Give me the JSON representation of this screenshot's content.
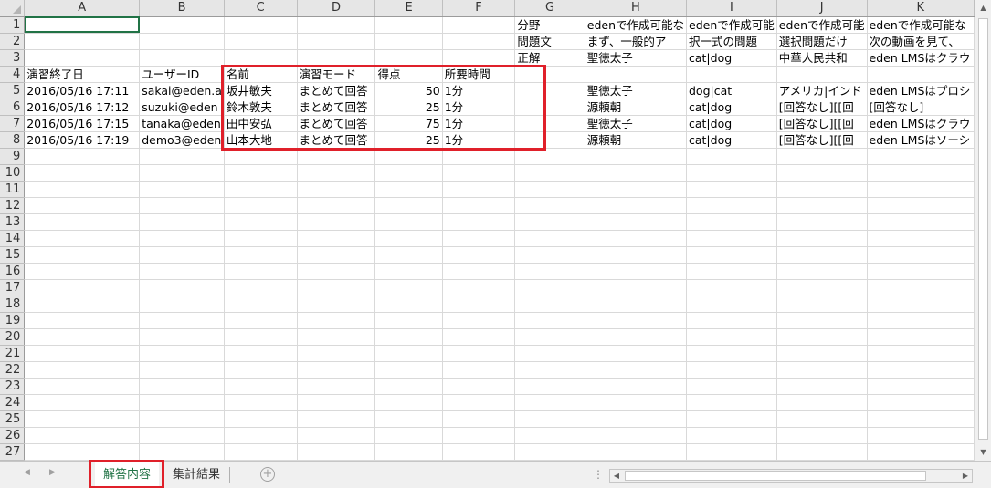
{
  "columns": [
    "A",
    "B",
    "C",
    "D",
    "E",
    "F",
    "G",
    "H",
    "I",
    "J",
    "K"
  ],
  "rows": [
    {
      "n": "1",
      "cells": [
        "",
        "",
        "",
        "",
        "",
        "",
        "分野",
        "edenで作成可能な",
        "edenで作成可能",
        "edenで作成可能",
        "edenで作成可能な"
      ]
    },
    {
      "n": "2",
      "cells": [
        "",
        "",
        "",
        "",
        "",
        "",
        "問題文",
        "まず、一般的ア",
        "択一式の問題",
        "選択問題だけ",
        "次の動画を見て、"
      ]
    },
    {
      "n": "3",
      "cells": [
        "",
        "",
        "",
        "",
        "",
        "",
        "正解",
        "聖徳太子",
        "cat|dog",
        "中華人民共和",
        "eden LMSはクラウ"
      ]
    },
    {
      "n": "4",
      "cells": [
        "演習終了日",
        "ユーザーID",
        "名前",
        "演習モード",
        "得点",
        "所要時間",
        "",
        "",
        "",
        "",
        ""
      ]
    },
    {
      "n": "5",
      "cells": [
        "2016/05/16 17:11",
        "sakai@eden.a",
        "坂井敏夫",
        "まとめて回答",
        "50",
        "1分",
        "",
        "聖徳太子",
        "dog|cat",
        "アメリカ|インド",
        "eden LMSはプロシ"
      ]
    },
    {
      "n": "6",
      "cells": [
        "2016/05/16 17:12",
        "suzuki@eden",
        "鈴木敦夫",
        "まとめて回答",
        "25",
        "1分",
        "",
        "源頼朝",
        "cat|dog",
        "[回答なし][[回",
        "[回答なし]"
      ]
    },
    {
      "n": "7",
      "cells": [
        "2016/05/16 17:15",
        "tanaka@eden",
        "田中安弘",
        "まとめて回答",
        "75",
        "1分",
        "",
        "聖徳太子",
        "cat|dog",
        "[回答なし][[回",
        "eden LMSはクラウ"
      ]
    },
    {
      "n": "8",
      "cells": [
        "2016/05/16 17:19",
        "demo3@eden",
        "山本大地",
        "まとめて回答",
        "25",
        "1分",
        "",
        "源頼朝",
        "cat|dog",
        "[回答なし][[回",
        "eden LMSはソーシ"
      ]
    },
    {
      "n": "9",
      "cells": [
        "",
        "",
        "",
        "",
        "",
        "",
        "",
        "",
        "",
        "",
        ""
      ]
    },
    {
      "n": "10",
      "cells": [
        "",
        "",
        "",
        "",
        "",
        "",
        "",
        "",
        "",
        "",
        ""
      ]
    },
    {
      "n": "11",
      "cells": [
        "",
        "",
        "",
        "",
        "",
        "",
        "",
        "",
        "",
        "",
        ""
      ]
    },
    {
      "n": "12",
      "cells": [
        "",
        "",
        "",
        "",
        "",
        "",
        "",
        "",
        "",
        "",
        ""
      ]
    },
    {
      "n": "13",
      "cells": [
        "",
        "",
        "",
        "",
        "",
        "",
        "",
        "",
        "",
        "",
        ""
      ]
    },
    {
      "n": "14",
      "cells": [
        "",
        "",
        "",
        "",
        "",
        "",
        "",
        "",
        "",
        "",
        ""
      ]
    },
    {
      "n": "15",
      "cells": [
        "",
        "",
        "",
        "",
        "",
        "",
        "",
        "",
        "",
        "",
        ""
      ]
    },
    {
      "n": "16",
      "cells": [
        "",
        "",
        "",
        "",
        "",
        "",
        "",
        "",
        "",
        "",
        ""
      ]
    },
    {
      "n": "17",
      "cells": [
        "",
        "",
        "",
        "",
        "",
        "",
        "",
        "",
        "",
        "",
        ""
      ]
    },
    {
      "n": "18",
      "cells": [
        "",
        "",
        "",
        "",
        "",
        "",
        "",
        "",
        "",
        "",
        ""
      ]
    },
    {
      "n": "19",
      "cells": [
        "",
        "",
        "",
        "",
        "",
        "",
        "",
        "",
        "",
        "",
        ""
      ]
    },
    {
      "n": "20",
      "cells": [
        "",
        "",
        "",
        "",
        "",
        "",
        "",
        "",
        "",
        "",
        ""
      ]
    },
    {
      "n": "21",
      "cells": [
        "",
        "",
        "",
        "",
        "",
        "",
        "",
        "",
        "",
        "",
        ""
      ]
    },
    {
      "n": "22",
      "cells": [
        "",
        "",
        "",
        "",
        "",
        "",
        "",
        "",
        "",
        "",
        ""
      ]
    },
    {
      "n": "23",
      "cells": [
        "",
        "",
        "",
        "",
        "",
        "",
        "",
        "",
        "",
        "",
        ""
      ]
    },
    {
      "n": "24",
      "cells": [
        "",
        "",
        "",
        "",
        "",
        "",
        "",
        "",
        "",
        "",
        ""
      ]
    },
    {
      "n": "25",
      "cells": [
        "",
        "",
        "",
        "",
        "",
        "",
        "",
        "",
        "",
        "",
        ""
      ]
    },
    {
      "n": "26",
      "cells": [
        "",
        "",
        "",
        "",
        "",
        "",
        "",
        "",
        "",
        "",
        ""
      ]
    },
    {
      "n": "27",
      "cells": [
        "",
        "",
        "",
        "",
        "",
        "",
        "",
        "",
        "",
        "",
        ""
      ]
    }
  ],
  "sheet_tabs": {
    "active": "解答内容",
    "other": "集計結果"
  },
  "icons": {
    "add_sheet": "plus-circle-icon",
    "nav_prev": "triangle-left-icon",
    "nav_next": "triangle-right-icon"
  },
  "colors": {
    "accent": "#217346",
    "highlight_box": "#e0202a",
    "header_bg": "#e6e6e6",
    "gridline": "#d9d9d9"
  }
}
